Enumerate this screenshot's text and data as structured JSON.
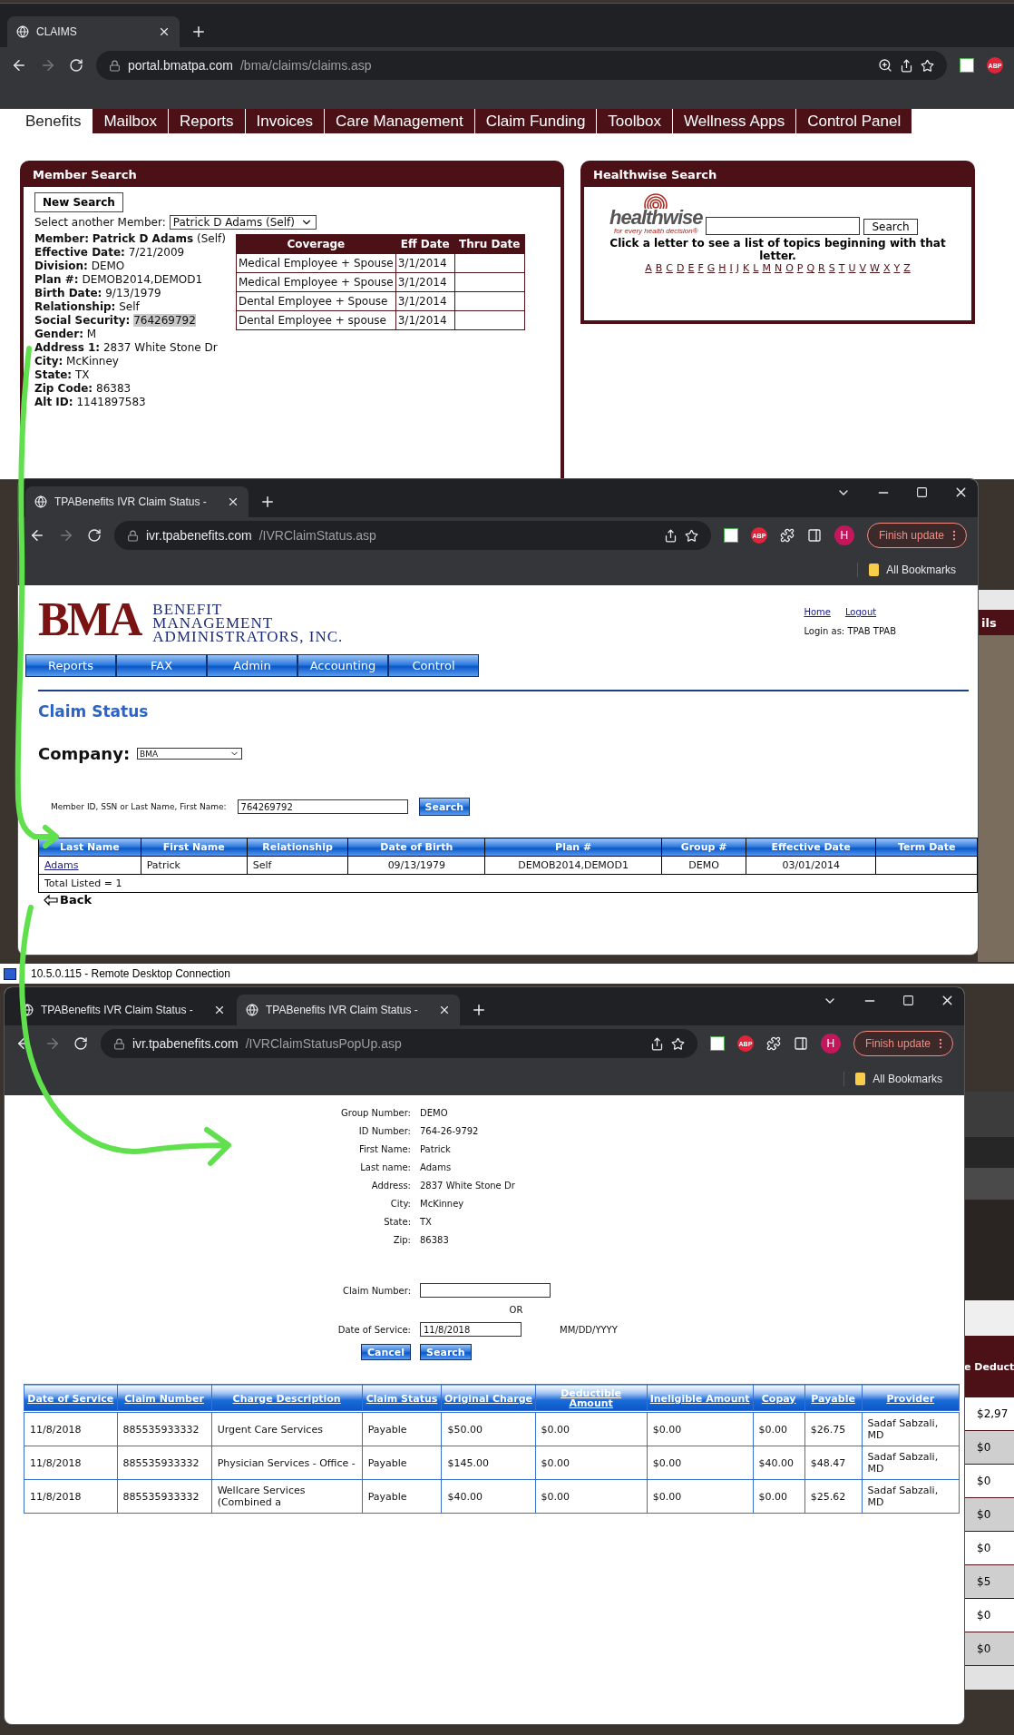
{
  "portal_window": {
    "tabs": [
      {
        "title": "CLAIMS",
        "selected": true
      }
    ],
    "url": {
      "host": "portal.bmatpa.com",
      "path": "/bma/claims/claims.asp"
    },
    "extension_badge": "ABP",
    "nav_tabs": [
      {
        "label": "Benefits",
        "selected": true
      },
      {
        "label": "Mailbox",
        "selected": false
      },
      {
        "label": "Reports",
        "selected": false
      },
      {
        "label": "Invoices",
        "selected": false
      },
      {
        "label": "Care Management",
        "selected": false
      },
      {
        "label": "Claim Funding",
        "selected": false
      },
      {
        "label": "Toolbox",
        "selected": false
      },
      {
        "label": "Wellness Apps",
        "selected": false
      },
      {
        "label": "Control Panel",
        "selected": false
      }
    ],
    "member_search": {
      "title": "Member Search",
      "new_search_button": "New Search",
      "select_label": "Select another Member:",
      "select_value": "Patrick D Adams (Self)",
      "fields": [
        {
          "label": "Member:",
          "value": "**Patrick D Adams** (Self)",
          "highlighted": false
        },
        {
          "label": "Effective Date:",
          "value": "7/21/2009",
          "highlighted": false
        },
        {
          "label": "Division:",
          "value": "DEMO",
          "highlighted": false
        },
        {
          "label": "Plan #:",
          "value": "DEMOB2014,DEMOD1",
          "highlighted": false
        },
        {
          "label": "Birth Date:",
          "value": "9/13/1979",
          "highlighted": false
        },
        {
          "label": "Relationship:",
          "value": "Self",
          "highlighted": false
        },
        {
          "label": "Social Security:",
          "value": "764269792",
          "highlighted": true
        },
        {
          "label": "Gender:",
          "value": "M",
          "highlighted": false
        },
        {
          "label": "Address 1:",
          "value": "2837 White Stone Dr",
          "highlighted": false
        },
        {
          "label": "City:",
          "value": "McKinney",
          "highlighted": false
        },
        {
          "label": "State:",
          "value": "TX",
          "highlighted": false
        },
        {
          "label": "Zip Code:",
          "value": "86383",
          "highlighted": false
        },
        {
          "label": "Alt ID:",
          "value": "1141897583",
          "highlighted": false
        }
      ],
      "coverage_table": {
        "columns": [
          "Coverage",
          "Eff Date",
          "Thru Date"
        ],
        "rows": [
          {
            "coverage": "Medical Employee + Spouse",
            "eff_date": "3/1/2014"
          },
          {
            "coverage": "Medical Employee + Spouse",
            "eff_date": "3/1/2014"
          },
          {
            "coverage": "Dental Employee + Spouse",
            "eff_date": "3/1/2014"
          },
          {
            "coverage": "Dental Employee + spouse",
            "eff_date": "3/1/2014"
          }
        ]
      }
    },
    "healthwise_search": {
      "title": "Healthwise Search",
      "logo_word": "healthwise",
      "logo_tagline": "for every health decision®",
      "button": "Search",
      "hint": "Click a letter to see a list of topics beginning with that letter.",
      "letters": [
        "A",
        "B",
        "C",
        "D",
        "E",
        "F",
        "G",
        "H",
        "I",
        "J",
        "K",
        "L",
        "M",
        "N",
        "O",
        "P",
        "Q",
        "R",
        "S",
        "T",
        "U",
        "V",
        "W",
        "X",
        "Y",
        "Z"
      ]
    }
  },
  "ivr_window": {
    "tabs": [
      {
        "title": "TPABenefits IVR Claim Status -",
        "selected": true
      }
    ],
    "url": {
      "host": "ivr.tpabenefits.com",
      "path": "/IVRClaimStatus.asp"
    },
    "extension_badge": "ABP",
    "profile_initial": "H",
    "update_button": "Finish update",
    "bookmarks_folder": "All Bookmarks",
    "logo": {
      "monogram": "BMA",
      "lines": [
        "BENEFIT",
        "MANAGEMENT",
        "ADMINISTRATORS, INC."
      ]
    },
    "header_links": [
      "Home",
      "Logout"
    ],
    "login": "Login as: TPAB TPAB",
    "menu": [
      "Reports",
      "FAX",
      "Admin",
      "Accounting",
      "Control"
    ],
    "heading": "Claim Status",
    "company": {
      "label": "Company:",
      "value": "BMA"
    },
    "member_search": {
      "label": "Member ID, SSN or Last Name, First Name:",
      "value": "764269792",
      "button": "Search"
    },
    "results": {
      "columns": [
        "Last Name",
        "First Name",
        "Relationship",
        "Date of Birth",
        "Plan #",
        "Group #",
        "Effective Date",
        "Term Date"
      ],
      "rows": [
        {
          "last_name": "Adams",
          "first_name": "Patrick",
          "relationship": "Self",
          "birth_date": "09/13/1979",
          "plan": "DEMOB2014,DEMOD1",
          "group": "DEMO",
          "effective_date": "03/01/2014"
        }
      ],
      "total": "Total Listed = 1"
    },
    "back_link": "Back"
  },
  "remote_desktop_bar": {
    "title": "10.5.0.115 - Remote Desktop Connection"
  },
  "popup_window": {
    "tabs": [
      {
        "title": "TPABenefits IVR Claim Status -",
        "selected": false
      },
      {
        "title": "TPABenefits IVR Claim Status -",
        "selected": true
      }
    ],
    "url": {
      "host": "ivr.tpabenefits.com",
      "path": "/IVRClaimStatusPopUp.asp"
    },
    "extension_badge": "ABP",
    "profile_initial": "H",
    "update_button": "Finish update",
    "bookmarks_folder": "All Bookmarks",
    "member_info": [
      {
        "label": "Group Number:",
        "value": "DEMO"
      },
      {
        "label": "ID Number:",
        "value": "764-26-9792"
      },
      {
        "label": "First Name:",
        "value": "Patrick"
      },
      {
        "label": "Last name:",
        "value": "Adams"
      },
      {
        "label": "Address:",
        "value": "2837 White Stone Dr"
      },
      {
        "label": "City:",
        "value": "McKinney"
      },
      {
        "label": "State:",
        "value": "TX"
      },
      {
        "label": "Zip:",
        "value": "86383"
      }
    ],
    "claim_number": {
      "label": "Claim Number:"
    },
    "separator": "OR",
    "date_of_service": {
      "label": "Date of Service:",
      "value": "11/8/2018",
      "format_hint": "MM/DD/YYYY"
    },
    "buttons": [
      "Cancel",
      "Search"
    ],
    "claims": {
      "columns": [
        "Date of Service",
        "Claim Number",
        "Charge Description",
        "Claim Status",
        "Original Charge",
        "Deductible Amount",
        "Ineligible Amount",
        "Copay",
        "Payable",
        "Provider"
      ],
      "rows": [
        {
          "date": "11/8/2018",
          "claim": "885535933332",
          "description": "Urgent Care Services",
          "status": "Payable",
          "original": "$50.00",
          "deductible": "$0.00",
          "ineligible": "$0.00",
          "copay": "$0.00",
          "payable": "$26.75",
          "provider": "Sadaf Sabzali, MD"
        },
        {
          "date": "11/8/2018",
          "claim": "885535933332",
          "description": "Physician Services - Office -",
          "status": "Payable",
          "original": "$145.00",
          "deductible": "$0.00",
          "ineligible": "$0.00",
          "copay": "$40.00",
          "payable": "$48.47",
          "provider": "Sadaf Sabzali, MD"
        },
        {
          "date": "11/8/2018",
          "claim": "885535933332",
          "description": "Wellcare Services (Combined a",
          "status": "Payable",
          "original": "$40.00",
          "deductible": "$0.00",
          "ineligible": "$0.00",
          "copay": "$0.00",
          "payable": "$25.62",
          "provider": "Sadaf Sabzali, MD"
        }
      ]
    }
  },
  "background_fragments": {
    "behind_ivr": "ils",
    "behind_popup": {
      "header": "e Deduct",
      "cells": [
        {
          "text": "$2,97",
          "shaded": false
        },
        {
          "text": "$0",
          "shaded": true
        },
        {
          "text": "$0",
          "shaded": false
        },
        {
          "text": "$0",
          "shaded": true
        },
        {
          "text": "$0",
          "shaded": false
        },
        {
          "text": "$5",
          "shaded": true
        },
        {
          "text": "$0",
          "shaded": false
        },
        {
          "text": "$0",
          "shaded": true
        }
      ]
    }
  }
}
